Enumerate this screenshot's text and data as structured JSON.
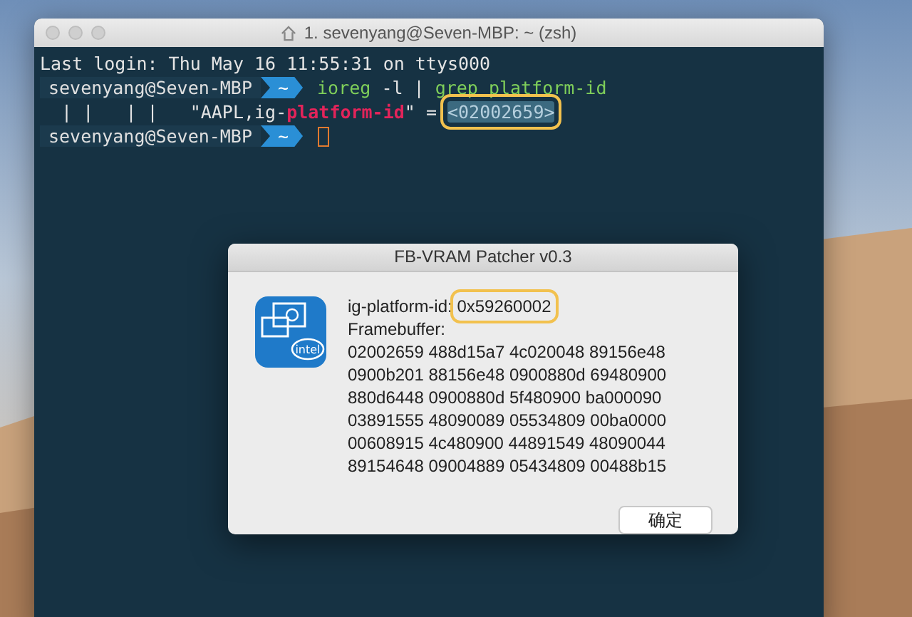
{
  "terminal": {
    "title": "1. sevenyang@Seven-MBP: ~ (zsh)",
    "lines": [
      {
        "kind": "plain",
        "segments": [
          {
            "text": "Last login: Thu May 16 11:55:31 on ttys000",
            "kind": "plain"
          }
        ]
      },
      {
        "kind": "prompt",
        "user": "sevenyang@Seven-MBP",
        "dir": "~",
        "cursor": false,
        "segments": [
          {
            "text": "ioreg",
            "kind": "command"
          },
          {
            "text": " -l | ",
            "kind": "plain"
          },
          {
            "text": "grep platform-id",
            "kind": "command"
          }
        ]
      },
      {
        "kind": "plain",
        "segments": [
          {
            "text": "  | |   | |   \"AAPL,ig-",
            "kind": "plain"
          },
          {
            "text": "platform-id",
            "kind": "match"
          },
          {
            "text": "\" = ",
            "kind": "plain"
          },
          {
            "text": "<02002659>",
            "kind": "selection",
            "highlighted": true
          }
        ]
      },
      {
        "kind": "prompt",
        "user": "sevenyang@Seven-MBP",
        "dir": "~",
        "cursor": true
      }
    ]
  },
  "dialog": {
    "title": "FB-VRAM Patcher v0.3",
    "icon_label": "intel",
    "lines": [
      {
        "segments": [
          {
            "text": "ig-platform-id: ",
            "highlighted": false
          },
          {
            "text": "0x59260002",
            "highlighted": true
          }
        ]
      },
      {
        "segments": [
          {
            "text": "Framebuffer:",
            "highlighted": false
          }
        ]
      },
      {
        "segments": [
          {
            "text": "02002659 488d15a7 4c020048 89156e48",
            "highlighted": false
          }
        ]
      },
      {
        "segments": [
          {
            "text": "0900b201 88156e48 0900880d 69480900",
            "highlighted": false
          }
        ]
      },
      {
        "segments": [
          {
            "text": "880d6448 0900880d 5f480900 ba000090",
            "highlighted": false
          }
        ]
      },
      {
        "segments": [
          {
            "text": "03891555 48090089 05534809 00ba0000",
            "highlighted": false
          }
        ]
      },
      {
        "segments": [
          {
            "text": "00608915 4c480900 44891549 48090044",
            "highlighted": false
          }
        ]
      },
      {
        "segments": [
          {
            "text": "89154648 09004889 05434809 00488b15",
            "highlighted": false
          }
        ]
      }
    ],
    "buttons": [
      "确定"
    ]
  }
}
